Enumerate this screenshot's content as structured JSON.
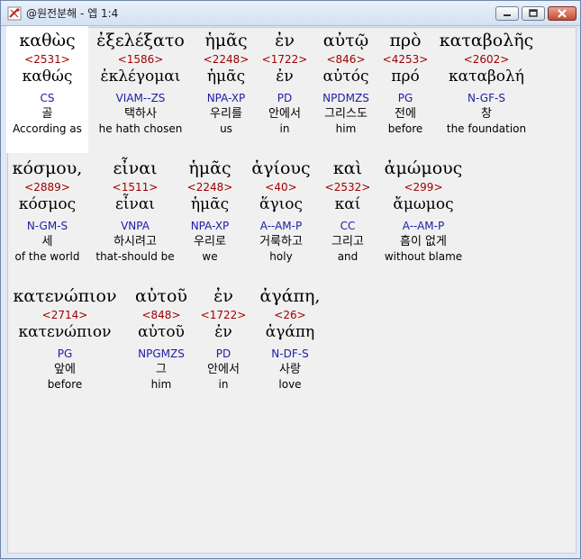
{
  "window": {
    "title": "@원전분해 - 엡 1:4"
  },
  "rows": [
    {
      "words": [
        {
          "greek": "καθὼς",
          "strong": "<2531>",
          "lemma": "καθώς",
          "parse": "CS",
          "korean": "골",
          "english": "According as"
        },
        {
          "greek": "ἐξελέξατο",
          "strong": "<1586>",
          "lemma": "ἐκλέγομαι",
          "parse": "VIAM--ZS",
          "korean": "택하사",
          "english": "he hath chosen"
        },
        {
          "greek": "ἡμᾶς",
          "strong": "<2248>",
          "lemma": "ἡμᾶς",
          "parse": "NPA-XP",
          "korean": "우리를",
          "english": "us"
        },
        {
          "greek": "ἐν",
          "strong": "<1722>",
          "lemma": "ἐν",
          "parse": "PD",
          "korean": "안에서",
          "english": "in"
        },
        {
          "greek": "αὐτῷ",
          "strong": "<846>",
          "lemma": "αὐτός",
          "parse": "NPDMZS",
          "korean": "그리스도",
          "english": "him"
        },
        {
          "greek": "πρὸ",
          "strong": "<4253>",
          "lemma": "πρό",
          "parse": "PG",
          "korean": "전에",
          "english": "before"
        },
        {
          "greek": "καταβολῆς",
          "strong": "<2602>",
          "lemma": "καταβολή",
          "parse": "N-GF-S",
          "korean": "창",
          "english": "the foundation"
        }
      ]
    },
    {
      "words": [
        {
          "greek": "κόσμου,",
          "strong": "<2889>",
          "lemma": "κόσμος",
          "parse": "N-GM-S",
          "korean": "세",
          "english": "of the world"
        },
        {
          "greek": "εἶναι",
          "strong": "<1511>",
          "lemma": "εἶναι",
          "parse": "VNPA",
          "korean": "하시려고",
          "english": "that-should be"
        },
        {
          "greek": "ἡμᾶς",
          "strong": "<2248>",
          "lemma": "ἡμᾶς",
          "parse": "NPA-XP",
          "korean": "우리로",
          "english": "we"
        },
        {
          "greek": "ἁγίους",
          "strong": "<40>",
          "lemma": "ἅγιος",
          "parse": "A--AM-P",
          "korean": "거룩하고",
          "english": "holy"
        },
        {
          "greek": "καὶ",
          "strong": "<2532>",
          "lemma": "καί",
          "parse": "CC",
          "korean": "그리고",
          "english": "and"
        },
        {
          "greek": "ἀμώμους",
          "strong": "<299>",
          "lemma": "ἄμωμος",
          "parse": "A--AM-P",
          "korean": "흠이 없게",
          "english": "without blame"
        }
      ]
    },
    {
      "words": [
        {
          "greek": "κατενώπιον",
          "strong": "<2714>",
          "lemma": "κατενώπιον",
          "parse": "PG",
          "korean": "앞에",
          "english": "before"
        },
        {
          "greek": "αὐτοῦ",
          "strong": "<848>",
          "lemma": "αὐτοῦ",
          "parse": "NPGMZS",
          "korean": "그",
          "english": "him"
        },
        {
          "greek": "ἐν",
          "strong": "<1722>",
          "lemma": "ἐν",
          "parse": "PD",
          "korean": "안에서",
          "english": "in"
        },
        {
          "greek": "ἀγάπη,",
          "strong": "<26>",
          "lemma": "ἀγάπη",
          "parse": "N-DF-S",
          "korean": "사랑",
          "english": "love"
        }
      ]
    }
  ]
}
